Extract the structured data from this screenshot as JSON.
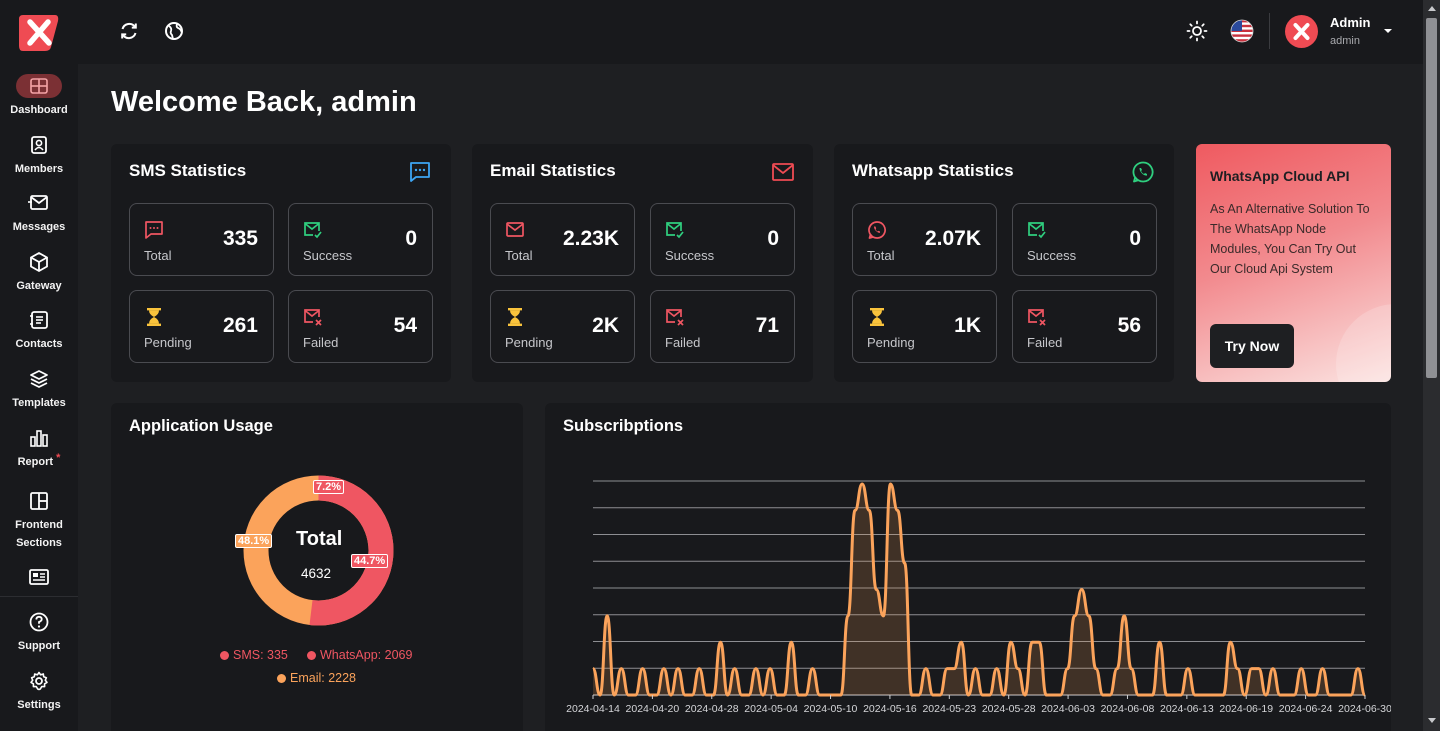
{
  "sidebar": {
    "items": [
      {
        "label": "Dashboard"
      },
      {
        "label": "Members"
      },
      {
        "label": "Messages"
      },
      {
        "label": "Gateway"
      },
      {
        "label": "Contacts"
      },
      {
        "label": "Templates"
      },
      {
        "label": "Report"
      },
      {
        "label": "Frontend Sections"
      }
    ],
    "bottom_items": [
      {
        "label": "Support"
      },
      {
        "label": "Settings"
      }
    ],
    "report_badge": "*"
  },
  "header": {
    "user_name": "Admin",
    "user_role": "admin"
  },
  "welcome": "Welcome Back, admin",
  "stats": [
    {
      "title": "SMS Statistics",
      "tiles": [
        {
          "label": "Total",
          "value": "335"
        },
        {
          "label": "Success",
          "value": "0"
        },
        {
          "label": "Pending",
          "value": "261"
        },
        {
          "label": "Failed",
          "value": "54"
        }
      ]
    },
    {
      "title": "Email Statistics",
      "tiles": [
        {
          "label": "Total",
          "value": "2.23K"
        },
        {
          "label": "Success",
          "value": "0"
        },
        {
          "label": "Pending",
          "value": "2K"
        },
        {
          "label": "Failed",
          "value": "71"
        }
      ]
    },
    {
      "title": "Whatsapp Statistics",
      "tiles": [
        {
          "label": "Total",
          "value": "2.07K"
        },
        {
          "label": "Success",
          "value": "0"
        },
        {
          "label": "Pending",
          "value": "1K"
        },
        {
          "label": "Failed",
          "value": "56"
        }
      ]
    }
  ],
  "promo": {
    "title": "WhatsApp Cloud API",
    "text": "As An Alternative Solution To The WhatsApp Node Modules, You Can Try Out Our Cloud Api System",
    "button": "Try Now"
  },
  "usage": {
    "title": "Application Usage",
    "center_label": "Total",
    "center_value": "4632",
    "pct_sms": "7.2%",
    "pct_whatsapp": "44.7%",
    "pct_email": "48.1%",
    "legend": [
      {
        "label": "SMS: 335",
        "color": "#ef5662"
      },
      {
        "label": "WhatsApp: 2069",
        "color": "#ef5662"
      },
      {
        "label": "Email: 2228",
        "color": "#fba35b"
      }
    ]
  },
  "subscriptions": {
    "title": "Subscribptions"
  },
  "colors": {
    "accent": "#ef4b53",
    "sms": "#ef5662",
    "email": "#fba35b",
    "whatsapp": "#2fcf7f",
    "success": "#2fcf7f",
    "pending": "#f9c33c",
    "info": "#3da5f4"
  },
  "chart_data": {
    "type": "area",
    "x": [
      "2024-04-14",
      "2024-04-20",
      "2024-04-28",
      "2024-05-04",
      "2024-05-10",
      "2024-05-16",
      "2024-05-23",
      "2024-05-28",
      "2024-06-03",
      "2024-06-08",
      "2024-06-13",
      "2024-06-19",
      "2024-06-24",
      "2024-06-30"
    ],
    "series": [
      {
        "values": [
          1,
          0,
          3,
          0,
          1,
          0,
          0,
          1,
          0,
          0,
          1,
          0,
          1,
          0,
          0,
          1,
          0,
          0,
          2,
          0,
          1,
          0,
          0,
          1,
          0,
          1,
          0,
          0,
          2,
          0,
          0,
          1,
          0,
          0,
          0,
          0,
          3,
          7,
          8,
          7,
          4,
          3,
          8,
          7,
          5,
          0,
          0,
          1,
          0,
          0,
          1,
          1,
          2,
          0,
          1,
          0,
          0,
          1,
          0,
          2,
          1,
          0,
          2,
          2,
          0,
          0,
          0,
          1,
          3,
          4,
          3,
          1,
          0,
          0,
          1,
          3,
          1,
          0,
          0,
          0,
          2,
          0,
          0,
          0,
          1,
          0,
          0,
          0,
          0,
          0,
          2,
          1,
          0,
          1,
          1,
          0,
          1,
          0,
          0,
          0,
          1,
          0,
          0,
          1,
          0,
          0,
          0,
          0,
          1,
          0
        ]
      }
    ],
    "y_gridlines": 8,
    "legend_position": "bottom",
    "grid": true
  }
}
